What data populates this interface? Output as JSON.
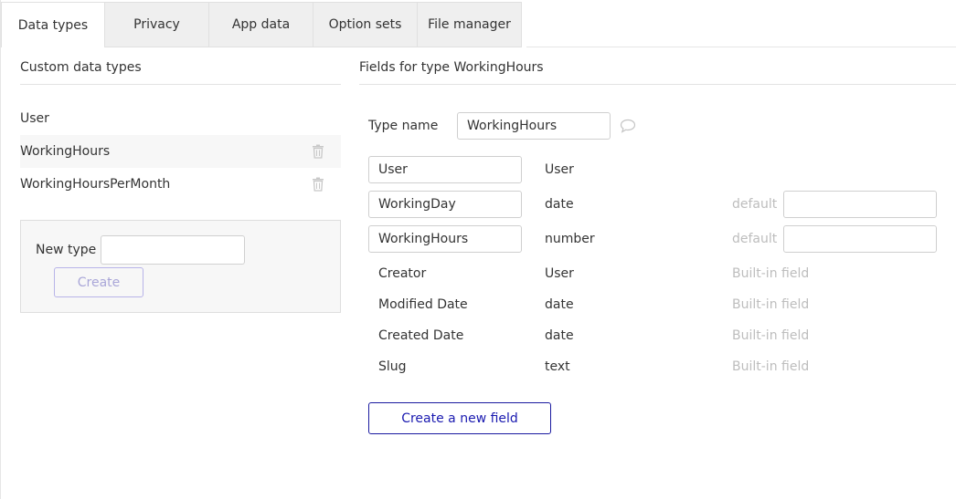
{
  "tabs": [
    {
      "label": "Data types",
      "active": true
    },
    {
      "label": "Privacy"
    },
    {
      "label": "App data"
    },
    {
      "label": "Option sets"
    },
    {
      "label": "File manager"
    }
  ],
  "left": {
    "title": "Custom data types",
    "types": [
      "User",
      "WorkingHours",
      "WorkingHoursPerMonth"
    ],
    "selected": "WorkingHours",
    "new_type_label": "New type",
    "new_type_value": "",
    "create_label": "Create"
  },
  "right": {
    "title": "Fields for type WorkingHours",
    "type_name_label": "Type name",
    "type_name_value": "WorkingHours",
    "fields": [
      {
        "name": "User",
        "type": "User",
        "editable": true,
        "note": ""
      },
      {
        "name": "WorkingDay",
        "type": "date",
        "editable": true,
        "note": "default"
      },
      {
        "name": "WorkingHours",
        "type": "number",
        "editable": true,
        "note": "default"
      },
      {
        "name": "Creator",
        "type": "User",
        "editable": false,
        "note": "Built-in field"
      },
      {
        "name": "Modified Date",
        "type": "date",
        "editable": false,
        "note": "Built-in field"
      },
      {
        "name": "Created Date",
        "type": "date",
        "editable": false,
        "note": "Built-in field"
      },
      {
        "name": "Slug",
        "type": "text",
        "editable": false,
        "note": "Built-in field"
      }
    ],
    "new_field_label": "Create a new field"
  },
  "icons": {
    "delete": "trash-icon",
    "comment": "speech-bubble-icon"
  },
  "colors": {
    "accent": "#1a1ab0",
    "disabled_button": "#a9a6d8",
    "muted_text": "#bdbdbd"
  }
}
